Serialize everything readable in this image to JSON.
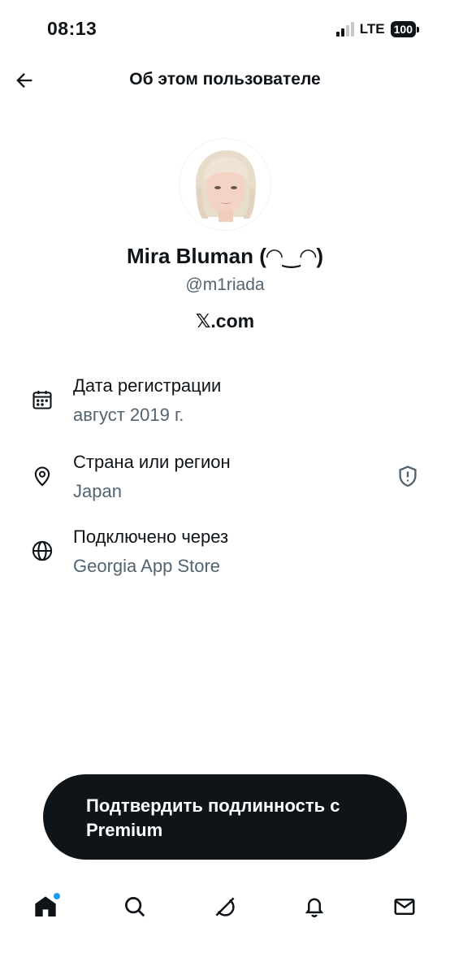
{
  "status_bar": {
    "time": "08:13",
    "network": "LTE",
    "battery": "100"
  },
  "header": {
    "title": "Об этом пользователе",
    "back_icon": "arrow-left-icon"
  },
  "profile": {
    "display_name": "Mira Bluman (◠‿◠)",
    "handle": "@m1riada",
    "site": "𝕏.com"
  },
  "info": [
    {
      "icon": "calendar-icon",
      "title": "Дата регистрации",
      "value": "август 2019 г."
    },
    {
      "icon": "location-pin-icon",
      "title": "Страна или регион",
      "value": "Japan",
      "badge_icon": "shield-alert-icon"
    },
    {
      "icon": "globe-icon",
      "title": "Подключено через",
      "value": "Georgia App Store"
    }
  ],
  "premium_button": {
    "label": "Подтвердить подлинность с Premium"
  },
  "tab_bar": {
    "tabs": [
      "home-icon",
      "search-icon",
      "grok-icon",
      "bell-icon",
      "mail-icon"
    ]
  },
  "colors": {
    "text": "#0f1419",
    "secondary": "#536471",
    "accent": "#1d9bf0",
    "button_bg": "#0f1419"
  }
}
